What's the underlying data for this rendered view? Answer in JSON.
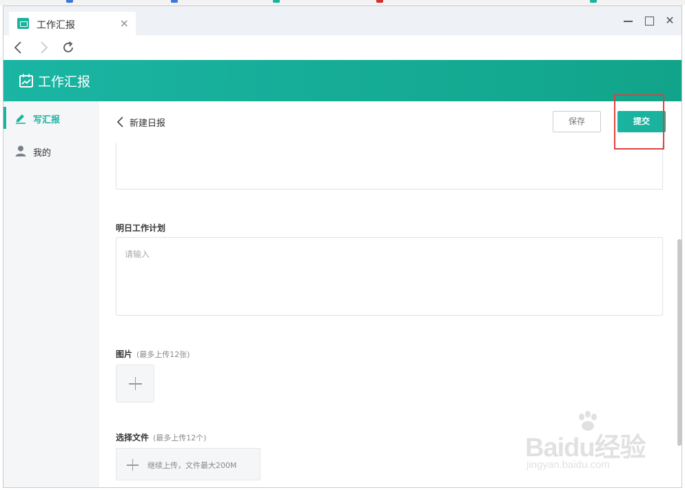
{
  "browser": {
    "tab_title": "工作汇报",
    "tab_close": "×",
    "window_close": "✕"
  },
  "app": {
    "title": "工作汇报",
    "accent_color": "#1ab39f"
  },
  "sidebar": {
    "items": [
      {
        "label": "写汇报",
        "icon": "pencil-icon",
        "active": true
      },
      {
        "label": "我的",
        "icon": "user-icon",
        "active": false
      }
    ]
  },
  "page": {
    "back_label": "新建日报",
    "save_label": "保存",
    "submit_label": "提交"
  },
  "form": {
    "plan_label": "明日工作计划",
    "plan_placeholder": "请输入",
    "images_label": "图片",
    "images_hint": "(最多上传12张)",
    "files_label": "选择文件",
    "files_hint": "(最多上传12个)",
    "files_button": "继续上传，文件最大200M"
  },
  "watermark": {
    "brand": "Baidu经验",
    "sub": "jingyan.baidu.com"
  }
}
